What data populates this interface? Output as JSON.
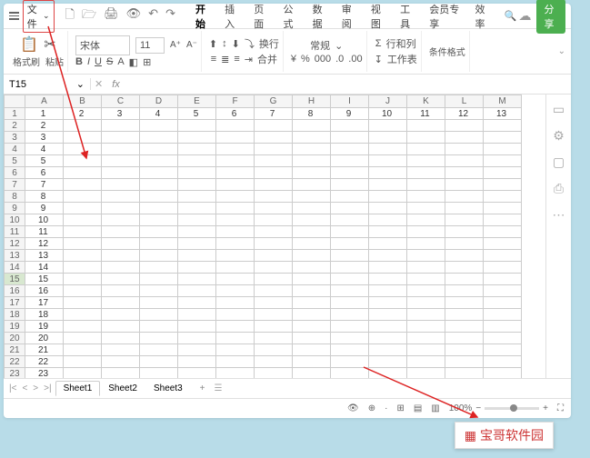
{
  "menubar": {
    "file": "文件",
    "tabs": [
      "开始",
      "插入",
      "页面",
      "公式",
      "数据",
      "审阅",
      "视图",
      "工具",
      "会员专享",
      "效率"
    ],
    "active_tab": 0,
    "share": "分享"
  },
  "ribbon": {
    "paint": "格式刷",
    "paste": "粘贴",
    "font": "宋体",
    "size": "11",
    "general": "常规",
    "wrap": "换行",
    "rowcol": "行和列",
    "worksheet": "工作表",
    "merge": "合并",
    "autosum": "求和",
    "conditional": "条件格式"
  },
  "namebox": "T15",
  "columns": [
    "A",
    "B",
    "C",
    "D",
    "E",
    "F",
    "G",
    "H",
    "I",
    "J",
    "K",
    "L",
    "M"
  ],
  "selected_row": 15,
  "row1_values": [
    1,
    2,
    3,
    4,
    5,
    6,
    7,
    8,
    9,
    10,
    11,
    12,
    13
  ],
  "row_count": 23,
  "sheets": [
    "Sheet1",
    "Sheet2",
    "Sheet3"
  ],
  "active_sheet": 0,
  "zoom": "100%",
  "watermark": "宝哥软件园"
}
